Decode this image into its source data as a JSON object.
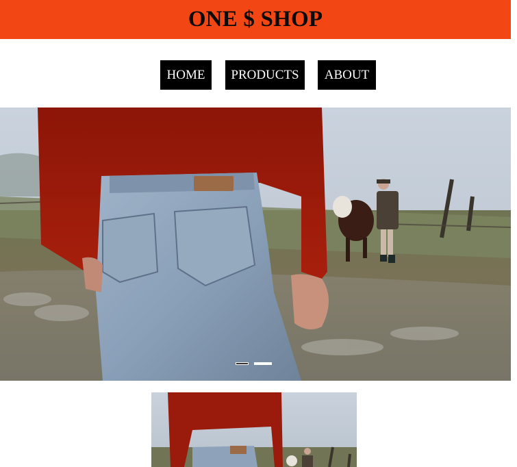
{
  "header": {
    "title": "ONE $ SHOP",
    "background_color": "#f24714"
  },
  "nav": {
    "items": [
      {
        "label": "HOME"
      },
      {
        "label": "PRODUCTS"
      },
      {
        "label": "ABOUT"
      }
    ]
  },
  "carousel": {
    "slide_count": 2,
    "active_slide": 2
  }
}
